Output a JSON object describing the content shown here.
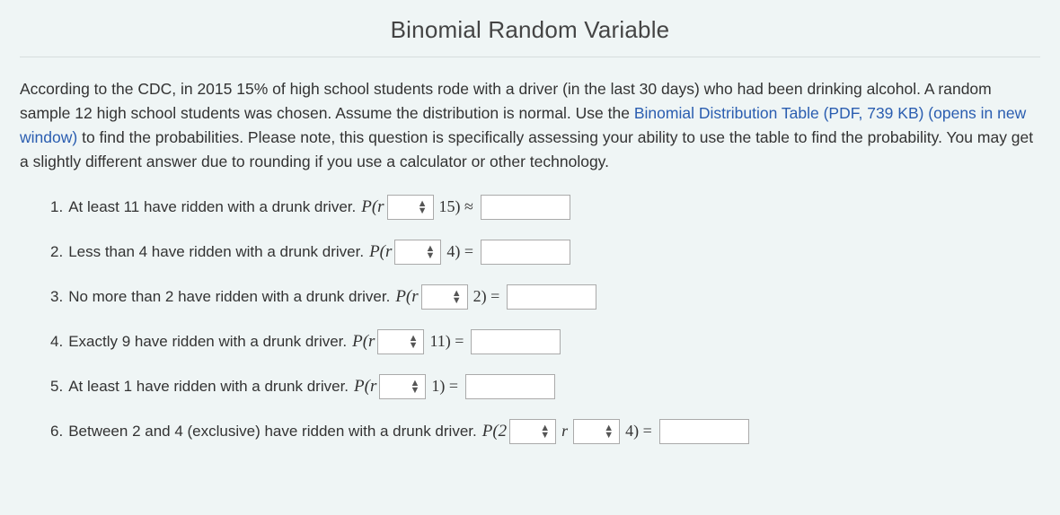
{
  "title": "Binomial Random Variable",
  "intro": {
    "part1": "According to the CDC, in 2015 15% of high school students rode with a driver (in the last 30 days) who had been drinking alcohol. A random sample 12 high school students was chosen. Assume the distribution is normal. Use the ",
    "link_text": "Binomial Distribution Table (PDF, 739 KB) (opens in new window)",
    "part2": " to find the probabilities. Please note, this question is specifically assessing your ability to use the table to find the probability. You may get a slightly different answer due to rounding if you use a calculator or other technology."
  },
  "q1": {
    "num": "1.",
    "text": "At least 11 have ridden with a drunk driver. ",
    "p": "P(r",
    "after": "15) ≈"
  },
  "q2": {
    "num": "2.",
    "text": "Less than 4 have ridden with a drunk driver. ",
    "p": "P(r",
    "after": "4) ="
  },
  "q3": {
    "num": "3.",
    "text": "No more than 2 have ridden with a drunk driver. ",
    "p": "P(r",
    "after": "2) ="
  },
  "q4": {
    "num": "4.",
    "text": "Exactly 9 have ridden with a drunk driver. ",
    "p": "P(r",
    "after": "11) ="
  },
  "q5": {
    "num": "5.",
    "text": "At least 1 have ridden with a drunk driver. ",
    "p": "P(r",
    "after": "1) ="
  },
  "q6": {
    "num": "6.",
    "text": "Between 2 and 4 (exclusive) have ridden with a drunk driver. ",
    "p": "P(2",
    "r": "r",
    "after": "4) ="
  }
}
